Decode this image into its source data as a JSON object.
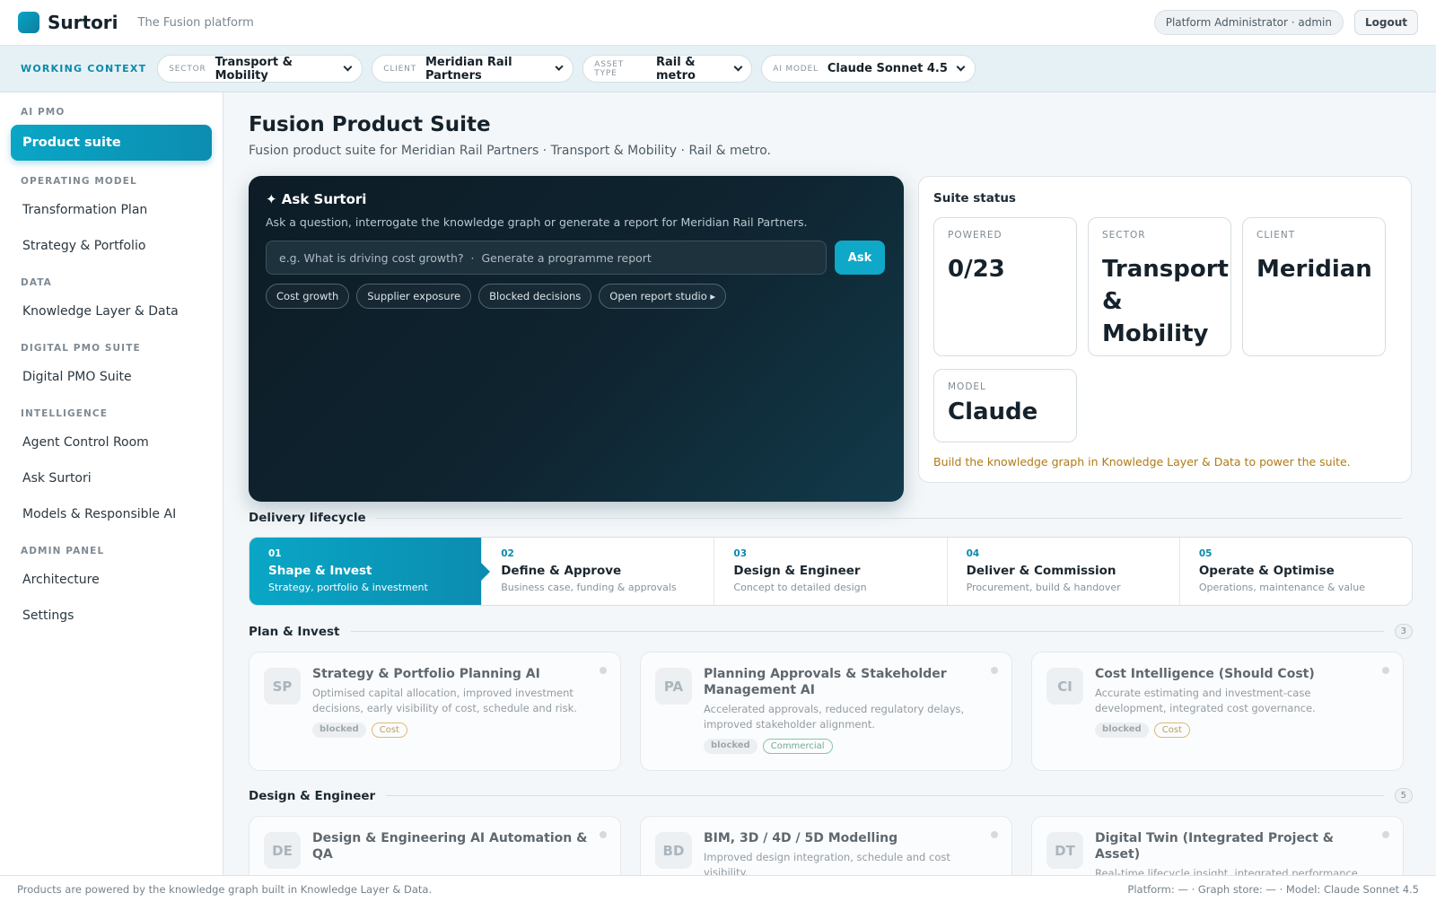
{
  "topbar": {
    "brand": "Surtori",
    "tagline": "The Fusion platform",
    "user": "Platform Administrator · admin",
    "logout": "Logout"
  },
  "context": {
    "label": "WORKING CONTEXT",
    "selects": [
      {
        "key": "SECTOR",
        "value": "Transport & Mobility"
      },
      {
        "key": "CLIENT",
        "value": "Meridian Rail Partners"
      },
      {
        "key": "ASSET TYPE",
        "value": "Rail & metro"
      },
      {
        "key": "AI MODEL",
        "value": "Claude Sonnet 4.5"
      }
    ]
  },
  "sidebar": {
    "sections": [
      {
        "title": "AI PMO",
        "items": [
          "Product suite"
        ]
      },
      {
        "title": "OPERATING MODEL",
        "items": [
          "Transformation Plan",
          "Strategy & Portfolio"
        ]
      },
      {
        "title": "DATA",
        "items": [
          "Knowledge Layer & Data"
        ]
      },
      {
        "title": "DIGITAL PMO SUITE",
        "items": [
          "Digital PMO Suite"
        ]
      },
      {
        "title": "INTELLIGENCE",
        "items": [
          "Agent Control Room",
          "Ask Surtori",
          "Models & Responsible AI"
        ]
      },
      {
        "title": "ADMIN PANEL",
        "items": [
          "Architecture",
          "Settings"
        ]
      }
    ]
  },
  "page": {
    "title": "Fusion Product Suite",
    "subtitle": "Fusion product suite for Meridian Rail Partners · Transport & Mobility · Rail & metro."
  },
  "ask": {
    "title": "✦ Ask Surtori",
    "desc": "Ask a question, interrogate the knowledge graph or generate a report for Meridian Rail Partners.",
    "placeholder": "e.g. What is driving cost growth?  ·  Generate a programme report",
    "button": "Ask",
    "chips": [
      "Cost growth",
      "Supplier exposure",
      "Blocked decisions",
      "Open report studio ▸"
    ]
  },
  "status": {
    "title": "Suite status",
    "stats": [
      {
        "key": "POWERED",
        "value": "0/23"
      },
      {
        "key": "SECTOR",
        "value": "Transport & Mobility"
      },
      {
        "key": "CLIENT",
        "value": "Meridian"
      },
      {
        "key": "MODEL",
        "value": "Claude"
      }
    ],
    "note": "Build the knowledge graph in Knowledge Layer & Data to power the suite."
  },
  "lifecycle": {
    "title": "Delivery lifecycle",
    "stages": [
      {
        "num": "01",
        "name": "Shape & Invest",
        "desc": "Strategy, portfolio & investment"
      },
      {
        "num": "02",
        "name": "Define & Approve",
        "desc": "Business case, funding & approvals"
      },
      {
        "num": "03",
        "name": "Design & Engineer",
        "desc": "Concept to detailed design"
      },
      {
        "num": "04",
        "name": "Deliver & Commission",
        "desc": "Procurement, build & handover"
      },
      {
        "num": "05",
        "name": "Operate & Optimise",
        "desc": "Operations, maintenance & value"
      }
    ]
  },
  "plan": {
    "title": "Plan & Invest",
    "count": "3",
    "products": [
      {
        "abbr": "SP",
        "title": "Strategy & Portfolio Planning AI",
        "desc": "Optimised capital allocation, improved investment decisions, early visibility of cost, schedule and risk.",
        "status": "blocked",
        "tag": "Cost"
      },
      {
        "abbr": "PA",
        "title": "Planning Approvals & Stakeholder Management AI",
        "desc": "Accelerated approvals, reduced regulatory delays, improved stakeholder alignment.",
        "status": "blocked",
        "tag": "Commercial"
      },
      {
        "abbr": "CI",
        "title": "Cost Intelligence (Should Cost)",
        "desc": "Accurate estimating and investment-case development, integrated cost governance.",
        "status": "blocked",
        "tag": "Cost"
      }
    ]
  },
  "design": {
    "title": "Design & Engineer",
    "count": "5",
    "products": [
      {
        "abbr": "DE",
        "title": "Design & Engineering AI Automation & QA",
        "desc": ""
      },
      {
        "abbr": "BD",
        "title": "BIM, 3D / 4D / 5D Modelling",
        "desc": "Improved design integration, schedule and cost visibility."
      },
      {
        "abbr": "DT",
        "title": "Digital Twin (Integrated Project & Asset)",
        "desc": "Real-time lifecycle insight, integrated performance."
      }
    ]
  },
  "footer": {
    "left": "Products are powered by the knowledge graph built in Knowledge Layer & Data.",
    "right": "Platform: — · Graph store: — · Model: Claude Sonnet 4.5"
  }
}
